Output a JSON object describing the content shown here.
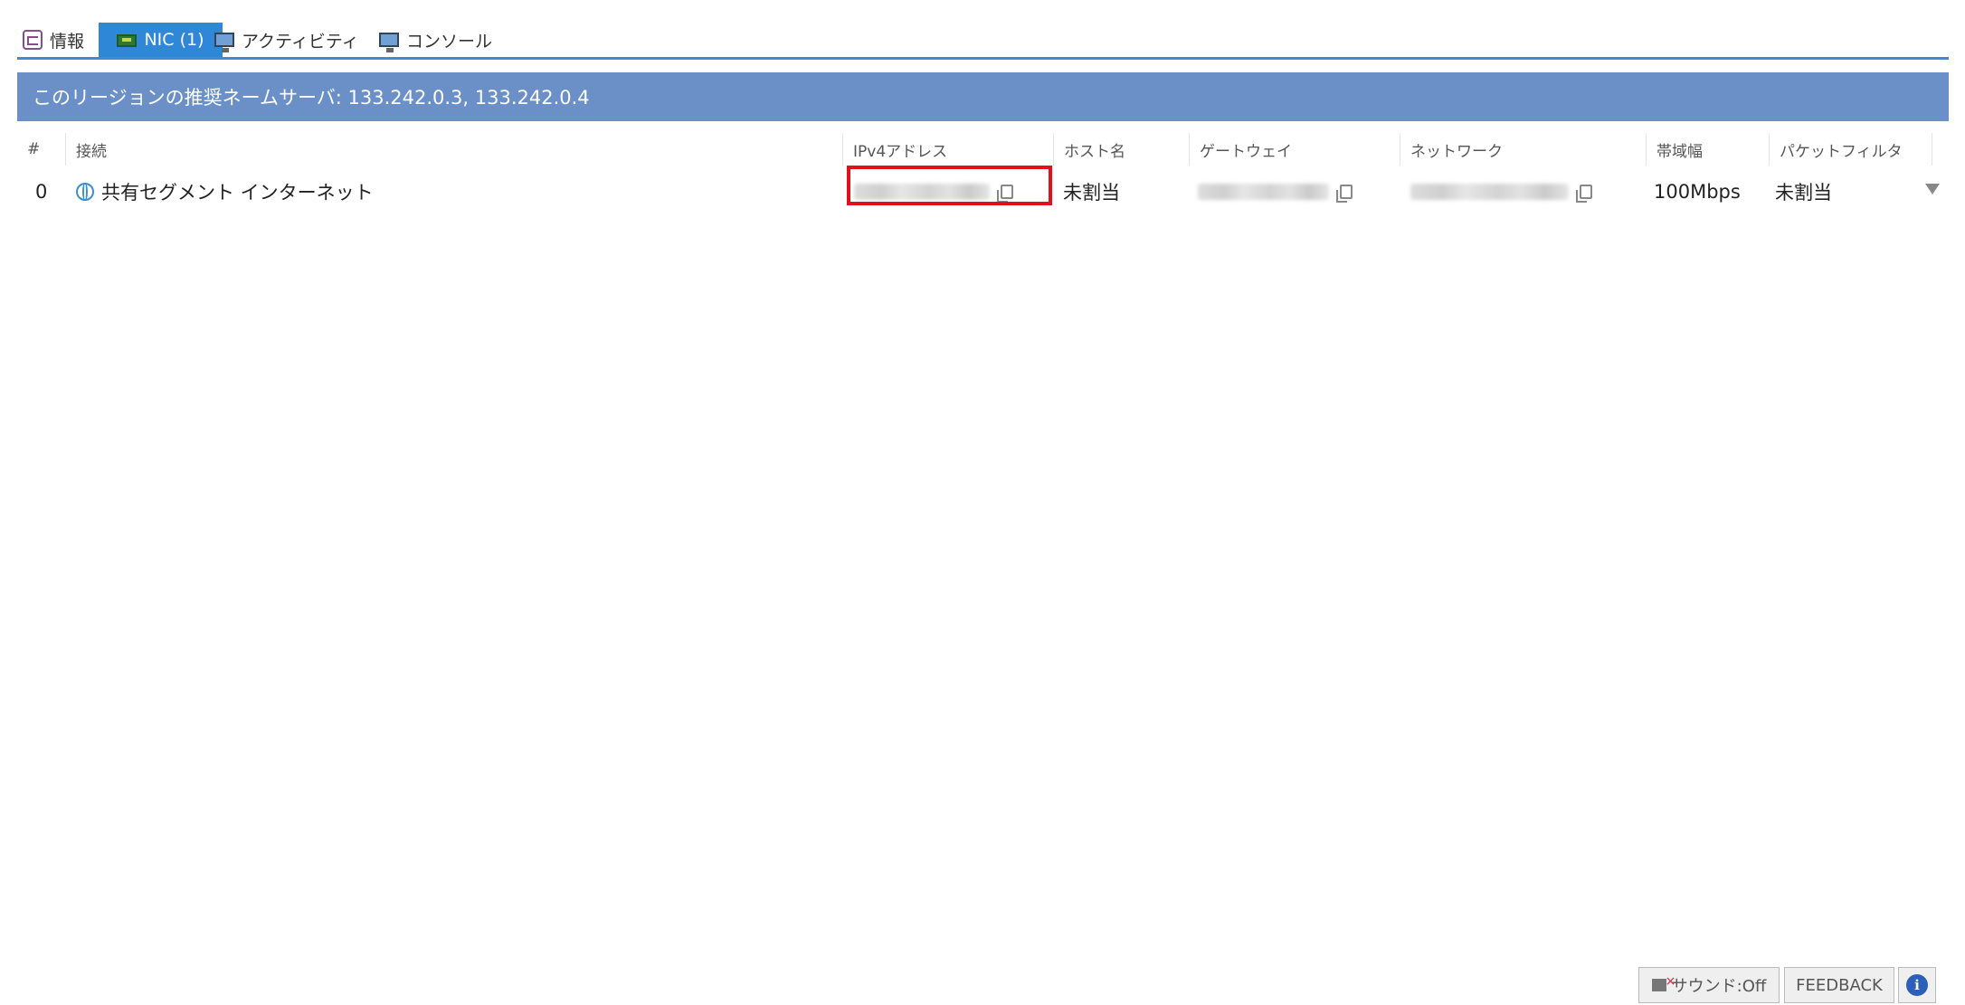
{
  "tabs": [
    {
      "label": "情報",
      "icon": "info-card-icon",
      "active": false
    },
    {
      "label": "NIC (1)",
      "icon": "nic-card-icon",
      "active": true
    },
    {
      "label": "アクティビティ",
      "icon": "monitor-icon",
      "active": false
    },
    {
      "label": "コンソール",
      "icon": "monitor-icon",
      "active": false
    }
  ],
  "banner": {
    "text": "このリージョンの推奨ネームサーバ: 133.242.0.3, 133.242.0.4"
  },
  "table": {
    "columns": [
      "#",
      "接続",
      "IPv4アドレス",
      "ホスト名",
      "ゲートウェイ",
      "ネットワーク",
      "帯域幅",
      "パケットフィルタ"
    ],
    "rows": [
      {
        "index": "0",
        "connection": "共有セグメント インターネット",
        "ipv4": "",
        "hostname": "未割当",
        "gateway": "",
        "network": "",
        "bandwidth": "100Mbps",
        "packet_filter": "未割当"
      }
    ]
  },
  "footer": {
    "sound_label": "サウンド:Off",
    "feedback_label": "FEEDBACK",
    "info_label": "i"
  },
  "colors": {
    "accent": "#2f87d8",
    "banner": "#6b8fc7",
    "highlight": "#e0101e"
  }
}
